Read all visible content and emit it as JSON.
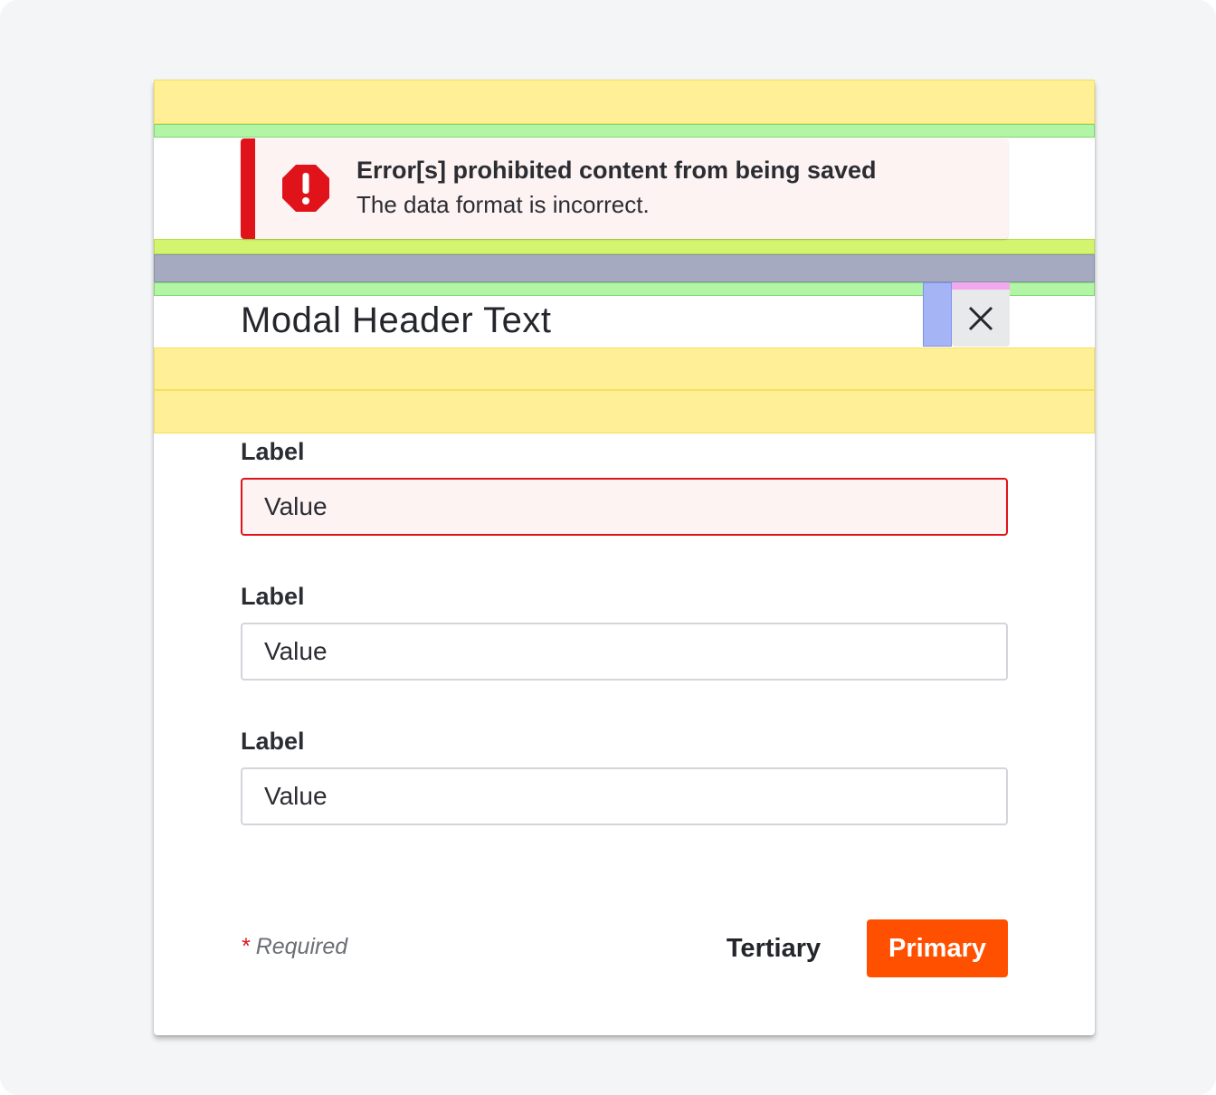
{
  "colors": {
    "error": "#e0131b",
    "error_bg": "#fdf3f3",
    "primary": "#ff5000",
    "text": "#2b2d33",
    "page_bg": "#f4f5f7"
  },
  "alert": {
    "icon": "error-octagon-icon",
    "title": "Error[s] prohibited content from being saved",
    "message": "The data format is incorrect."
  },
  "modal": {
    "header": "Modal Header Text",
    "close_icon": "close-icon"
  },
  "fields": [
    {
      "label": "Label",
      "value": "Value",
      "state": "error"
    },
    {
      "label": "Label",
      "value": "Value",
      "state": "default"
    },
    {
      "label": "Label",
      "value": "Value",
      "state": "default"
    }
  ],
  "footer": {
    "required_star": "*",
    "required_text": "Required",
    "tertiary_label": "Tertiary",
    "primary_label": "Primary"
  }
}
